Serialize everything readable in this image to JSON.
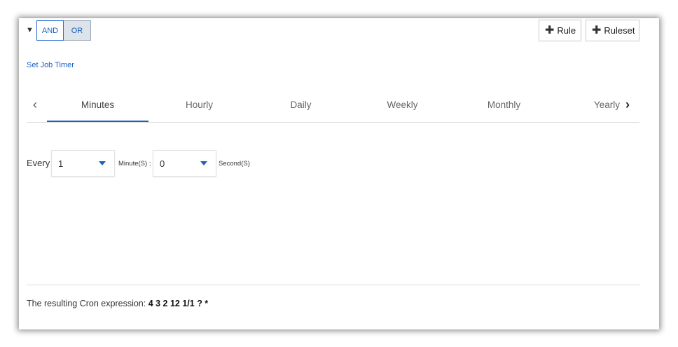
{
  "query": {
    "collapse_glyph": "▼",
    "and_label": "AND",
    "or_label": "OR",
    "add_rule_label": "Rule",
    "add_ruleset_label": "Ruleset"
  },
  "job_timer_link": "Set Job Timer",
  "tabs": [
    {
      "label": "Minutes",
      "active": true
    },
    {
      "label": "Hourly"
    },
    {
      "label": "Daily"
    },
    {
      "label": "Weekly"
    },
    {
      "label": "Monthly"
    },
    {
      "label": "Yearly"
    }
  ],
  "minutes_tab": {
    "every_label": "Every",
    "minutes_value": "1",
    "minutes_unit": "Minute(S) :",
    "seconds_value": "0",
    "seconds_unit": "Second(S)"
  },
  "cron": {
    "prefix": "The resulting Cron expression: ",
    "expression": "4 3 2 12 1/1 ? *"
  },
  "colors": {
    "accent": "#1b5fbf",
    "or_bg": "#dde3ea"
  }
}
